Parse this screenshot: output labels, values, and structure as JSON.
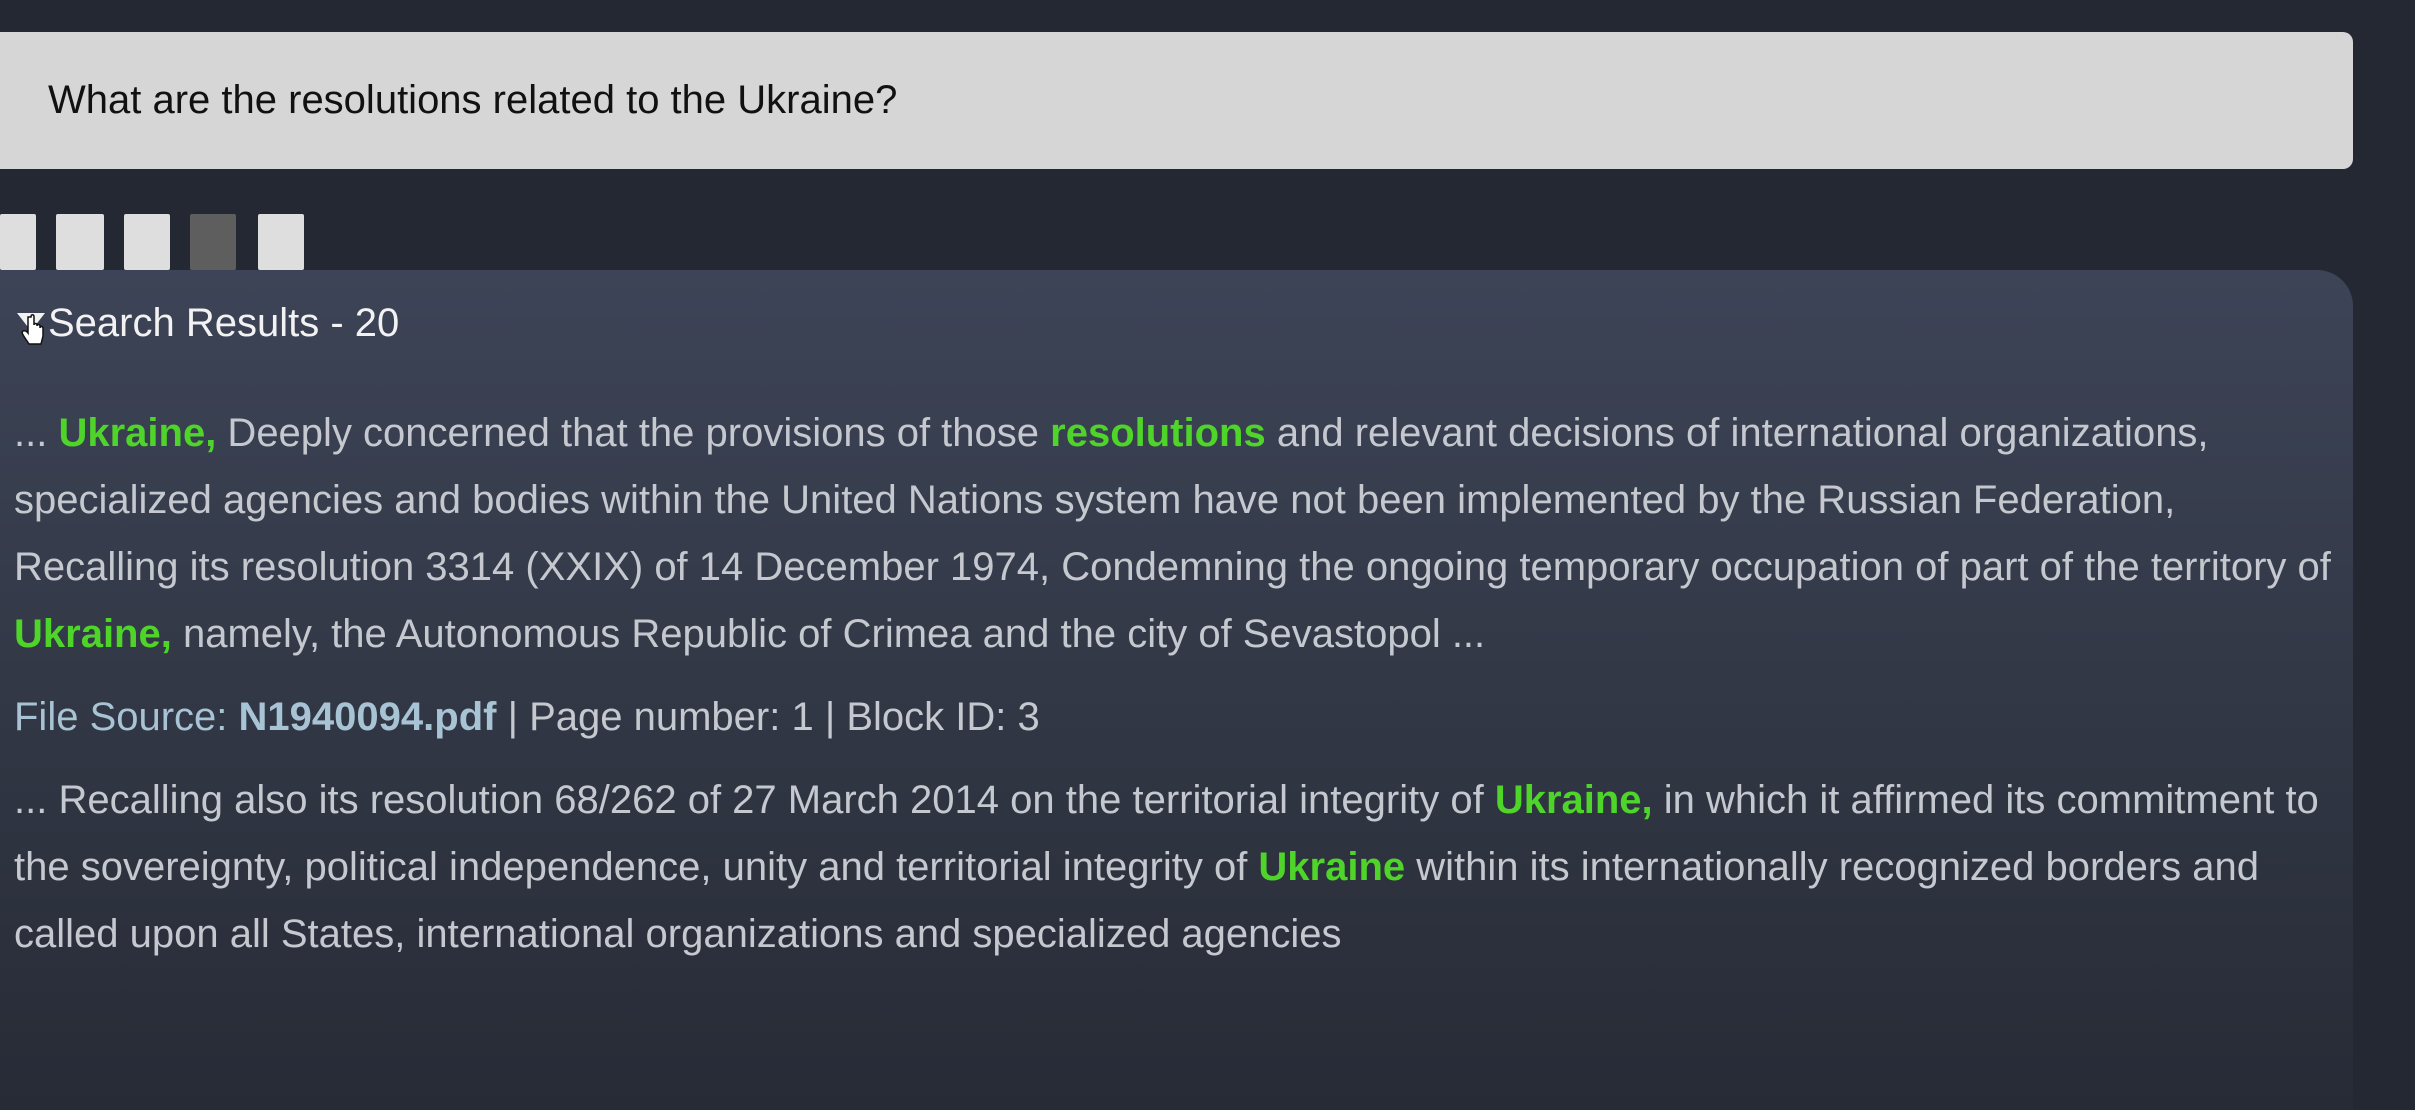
{
  "query": {
    "text": "What are the resolutions related to the Ukraine?"
  },
  "toolbar": {
    "buttons": [
      "light",
      "light",
      "light",
      "dark",
      "light"
    ]
  },
  "results": {
    "label": "Search Results",
    "separator": " - ",
    "count": "20",
    "toggle_icon": "caret-down-icon",
    "items": [
      {
        "seg1": "... ",
        "hl1": "Ukraine,",
        "seg2": " Deeply concerned that the provisions of those ",
        "hl2": "resolutions",
        "seg3": " and relevant decisions of international organizations, specialized agencies and bodies within the United Nations system have not been implemented by the Russian Federation, Recalling its resolution 3314 (XXIX) of 14 December 1974, Condemning the ongoing temporary occupation of part of the territory of ",
        "hl3": "Ukraine,",
        "seg4": " namely, the Autonomous Republic of Crimea and the city of Sevastopol ...",
        "source_label": "File Source:",
        "file": "N1940094.pdf",
        "meta": " | Page number: 1 | Block ID: 3"
      },
      {
        "seg1": "... Recalling also its resolution 68/262 of 27 March 2014 on the territorial integrity of ",
        "hl1": "Ukraine,",
        "seg2": " in which it affirmed its commitment to the sovereignty, political independence, unity and territorial integrity of ",
        "hl2": "Ukraine",
        "seg3": " within its internationally recognized borders and called upon all States, international organizations and specialized agencies"
      }
    ]
  },
  "colors": {
    "background": "#242833",
    "query_bar": "#d6d6d6",
    "highlight": "#4fd42a",
    "source_link": "#a7c3d4"
  }
}
